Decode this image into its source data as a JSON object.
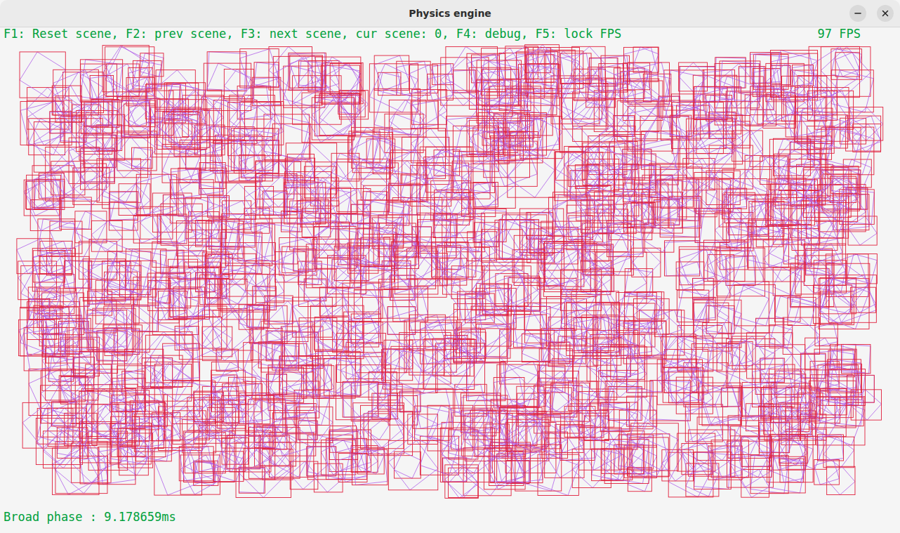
{
  "window": {
    "title": "Physics engine"
  },
  "hud": {
    "help": "F1: Reset scene, F2: prev scene, F3: next scene, cur scene: 0, F4: debug, F5: lock FPS",
    "fps": "97 FPS",
    "broad_phase": "Broad phase : 9.178659ms"
  }
}
